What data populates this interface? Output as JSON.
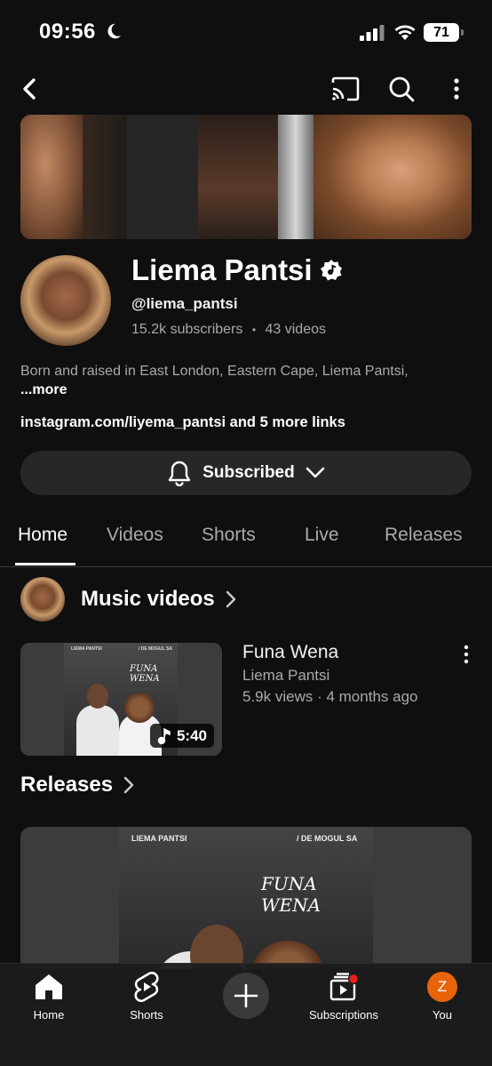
{
  "status_bar": {
    "time": "09:56",
    "battery": "71"
  },
  "channel": {
    "name": "Liema Pantsi",
    "handle": "@liema_pantsi",
    "subscribers": "15.2k subscribers",
    "separator": "•",
    "videos": "43 videos",
    "bio": "Born and raised in East London, Eastern Cape, Liema Pantsi, ",
    "bio_more": "...more",
    "links": "instagram.com/liyema_pantsi and 5 more links",
    "subscribe_label": "Subscribed"
  },
  "tabs": [
    "Home",
    "Videos",
    "Shorts",
    "Live",
    "Releases"
  ],
  "music_section": {
    "title": "Music videos"
  },
  "video": {
    "title": "Funa Wena",
    "channel": "Liema Pantsi",
    "meta": "5.9k views · 4 months ago",
    "duration": "5:40",
    "art_artist": "LIEMA PANTSI",
    "art_feature": "/ DE MOGUL SA",
    "art_title": "FUNA WENA"
  },
  "releases_section": {
    "title": "Releases",
    "art_artist": "LIEMA PANTSI",
    "art_feature": "/ DE MOGUL SA",
    "art_title": "FUNA WENA"
  },
  "bottom_nav": {
    "home": "Home",
    "shorts": "Shorts",
    "subscriptions": "Subscriptions",
    "you": "You",
    "you_initial": "Z"
  },
  "colors": {
    "background": "#0f0f0f",
    "subscribe_bg": "#272727",
    "you_avatar": "#e8630a",
    "notification_dot": "#e62117"
  }
}
